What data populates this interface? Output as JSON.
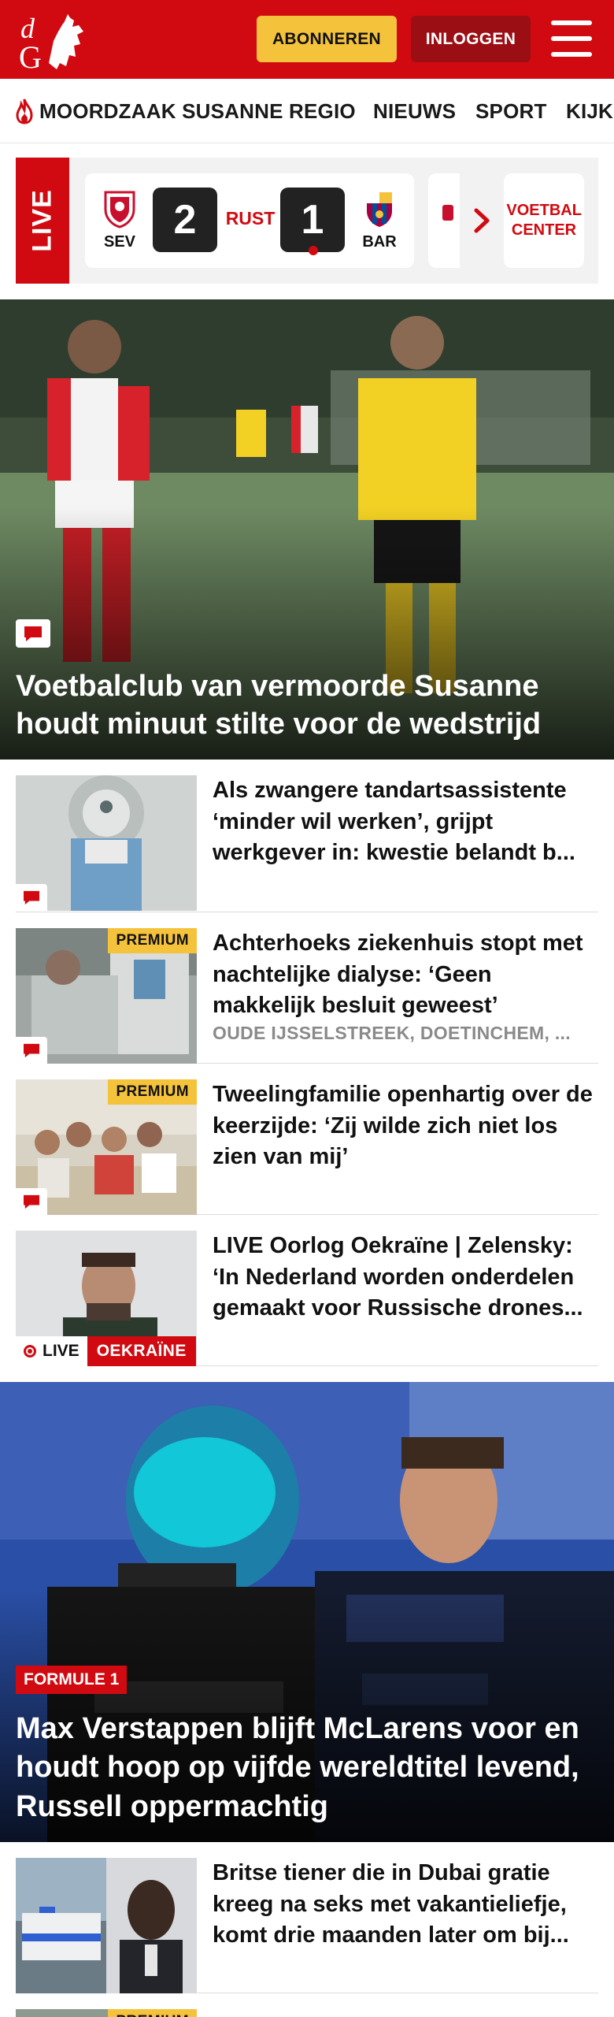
{
  "header": {
    "subscribe_label": "ABONNEREN",
    "login_label": "INLOGGEN",
    "colors": {
      "brand_red": "#d10a11",
      "subscribe_yellow": "#f5c33b",
      "login_dark_red": "#9b0e14"
    }
  },
  "nav": {
    "items": [
      {
        "label": "MOORDZAAK SUSANNE",
        "icon": "flame-icon"
      },
      {
        "label": "REGIO"
      },
      {
        "label": "NIEUWS"
      },
      {
        "label": "SPORT"
      },
      {
        "label": "KIJK"
      }
    ]
  },
  "live_scores": {
    "live_label": "LIVE",
    "match": {
      "home": {
        "abbr": "SEV",
        "score": "2"
      },
      "status": "RUST",
      "away": {
        "abbr": "BAR",
        "score": "1"
      }
    },
    "center_label": "VOETBAL CENTER"
  },
  "hero1": {
    "title": "Voetbalclub van vermoorde Susanne houdt minuut stilte voor de wedstrijd",
    "has_comments": true
  },
  "articles": [
    {
      "title": "Als zwangere tandartsassistente ‘minder wil werken’, grijpt werkgever in: kwestie belandt b...",
      "premium": false,
      "has_comments": true
    },
    {
      "title": "Achterhoeks ziekenhuis stopt met nachtelijke dialyse: ‘Geen makkelijk besluit geweest’",
      "meta": "OUDE IJSSELSTREEK, DOETINCHEM, ...",
      "premium": true,
      "premium_label": "PREMIUM",
      "has_comments": true
    },
    {
      "title": "Tweelingfamilie openhartig over de keerzijde: ‘Zij wilde zich niet los zien van mij’",
      "premium": true,
      "premium_label": "PREMIUM",
      "has_comments": true
    },
    {
      "title": "LIVE Oorlog Oekraïne | Zelensky: ‘In Nederland worden onderdelen gemaakt voor Russische drones...",
      "live_label": "LIVE",
      "tag": "OEKRAÏNE"
    }
  ],
  "hero2": {
    "tag": "FORMULE 1",
    "title": "Max Verstappen blijft McLarens voor en houdt hoop op vijfde wereldtitel levend, Russell oppermachtig"
  },
  "articles2": [
    {
      "title": "Britse tiener die in Dubai gratie kreeg na seks met vakantieliefje, komt drie maanden later om bij..."
    },
    {
      "premium_label": "PREMIUM"
    }
  ]
}
